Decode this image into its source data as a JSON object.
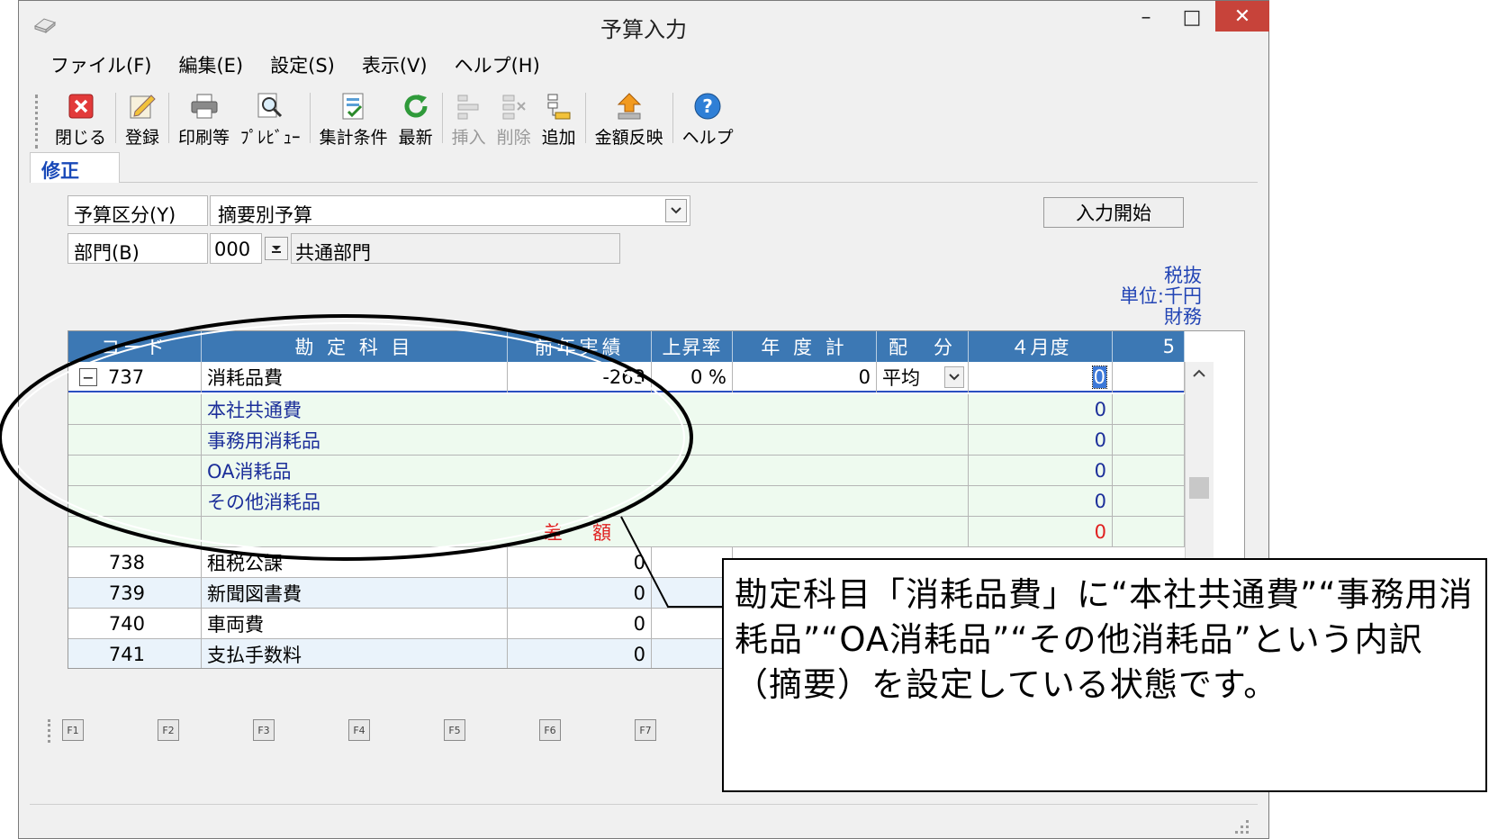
{
  "window": {
    "title": "予算入力",
    "min_glyph": "–",
    "max_glyph": "□",
    "close_glyph": "✕"
  },
  "menu": [
    {
      "label": "ファイル(F)"
    },
    {
      "label": "編集(E)"
    },
    {
      "label": "設定(S)"
    },
    {
      "label": "表示(V)"
    },
    {
      "label": "ヘルプ(H)"
    }
  ],
  "toolbar": {
    "close": "閉じる",
    "register": "登録",
    "print": "印刷等",
    "preview": "ﾌﾟﾚﾋﾞｭｰ",
    "conditions": "集計条件",
    "refresh": "最新",
    "insert": "挿入",
    "delete": "削除",
    "add": "追加",
    "apply_amount": "金額反映",
    "help": "ヘルプ"
  },
  "tab": {
    "label": "修正"
  },
  "form": {
    "budget_type_label": "予算区分(Y)",
    "budget_type_value": "摘要別予算",
    "dept_label": "部門(B)",
    "dept_code": "000",
    "dept_name": "共通部門",
    "start_button": "入力開始"
  },
  "unit_info": {
    "tax": "税抜",
    "unit": "単位:千円",
    "category": "財務"
  },
  "grid": {
    "headers": {
      "code": "コード",
      "account": "勘 定 科 目",
      "prev": "前年実績",
      "rate": "上昇率",
      "year_total": "年 度 計",
      "dist": "配　分",
      "april": "４月度",
      "may": "5"
    },
    "main_row": {
      "toggle": "−",
      "code": "737",
      "account": "消耗品費",
      "prev": "-263",
      "rate": "0 %",
      "year_total": "0",
      "dist": "平均",
      "april": "0"
    },
    "sub_rows": [
      {
        "name": "本社共通費",
        "april": "0"
      },
      {
        "name": "事務用消耗品",
        "april": "0"
      },
      {
        "name": "OA消耗品",
        "april": "0"
      },
      {
        "name": "その他消耗品",
        "april": "0"
      }
    ],
    "diff_row": {
      "label": "差　額",
      "april": "0"
    },
    "rows": [
      {
        "code": "738",
        "account": "租税公課",
        "prev": "0"
      },
      {
        "code": "739",
        "account": "新聞図書費",
        "prev": "0"
      },
      {
        "code": "740",
        "account": "車両費",
        "prev": "0"
      },
      {
        "code": "741",
        "account": "支払手数料",
        "prev": "0"
      }
    ]
  },
  "fkeys": [
    "F1",
    "F2",
    "F3",
    "F4",
    "F5",
    "F6",
    "F7"
  ],
  "callout": {
    "text": "勘定科目「消耗品費」に“本社共通費”“事務用消耗品”“OA消耗品”“その他消耗品”という内訳（摘要）を設定している状態です。"
  },
  "colors": {
    "header_blue": "#3c78b4",
    "sub_text": "#1c2f9a",
    "diff_red": "#e02020",
    "close_red": "#c7433a"
  }
}
